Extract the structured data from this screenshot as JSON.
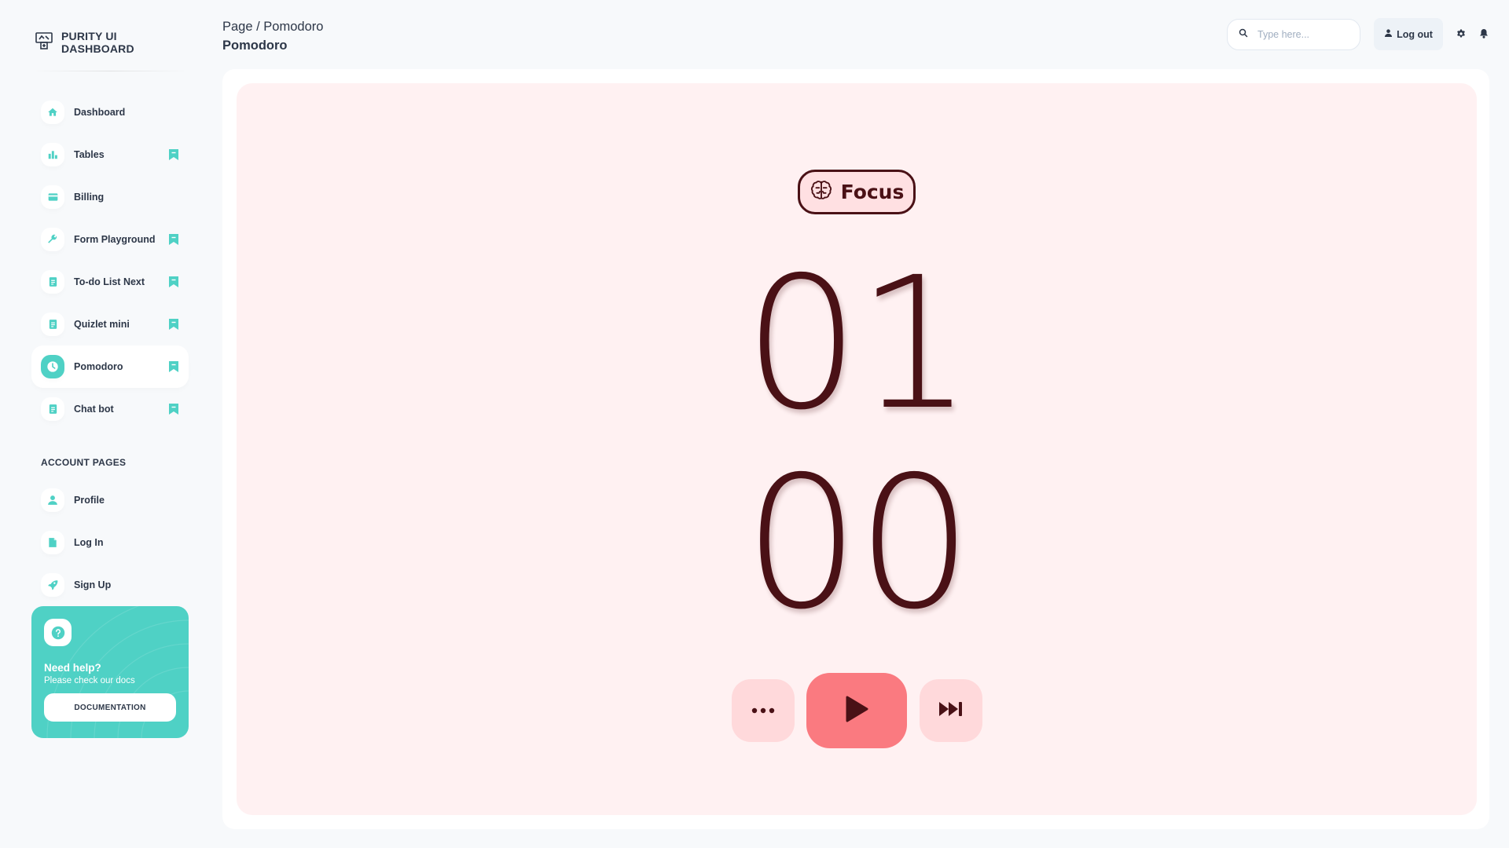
{
  "brand": {
    "title": "PURITY UI DASHBOARD",
    "icon": "dashboard-logo-icon"
  },
  "sidebar": {
    "items": [
      {
        "label": "Dashboard",
        "icon": "home-icon",
        "bookmarked": false,
        "active": false
      },
      {
        "label": "Tables",
        "icon": "bar-chart-icon",
        "bookmarked": true,
        "active": false
      },
      {
        "label": "Billing",
        "icon": "credit-card-icon",
        "bookmarked": false,
        "active": false
      },
      {
        "label": "Form Playground",
        "icon": "wrench-icon",
        "bookmarked": true,
        "active": false
      },
      {
        "label": "To-do List Next",
        "icon": "document-icon",
        "bookmarked": true,
        "active": false
      },
      {
        "label": "Quizlet mini",
        "icon": "document-icon",
        "bookmarked": true,
        "active": false
      },
      {
        "label": "Pomodoro",
        "icon": "clock-icon",
        "bookmarked": true,
        "active": true
      },
      {
        "label": "Chat bot",
        "icon": "document-icon",
        "bookmarked": true,
        "active": false
      }
    ],
    "section_title": "ACCOUNT PAGES",
    "account_items": [
      {
        "label": "Profile",
        "icon": "person-icon"
      },
      {
        "label": "Log In",
        "icon": "file-icon"
      },
      {
        "label": "Sign Up",
        "icon": "rocket-icon"
      }
    ],
    "help": {
      "icon": "question-icon",
      "title": "Need help?",
      "subtitle": "Please check our docs",
      "button": "DOCUMENTATION"
    }
  },
  "header": {
    "breadcrumb": "Page / Pomodoro",
    "title": "Pomodoro",
    "search_placeholder": "Type here...",
    "logout_label": "Log out"
  },
  "pomodoro": {
    "mode_label": "Focus",
    "mode_icon": "brain-icon",
    "minutes": "01",
    "seconds": "00",
    "controls": [
      "more-icon",
      "play-icon",
      "skip-forward-icon"
    ]
  },
  "colors": {
    "accent": "#4fd1c5",
    "timer_text": "#4a1116",
    "timer_bg": "#fff1f2",
    "play_button": "#fa7a80",
    "secondary_button": "#ffd9db"
  }
}
